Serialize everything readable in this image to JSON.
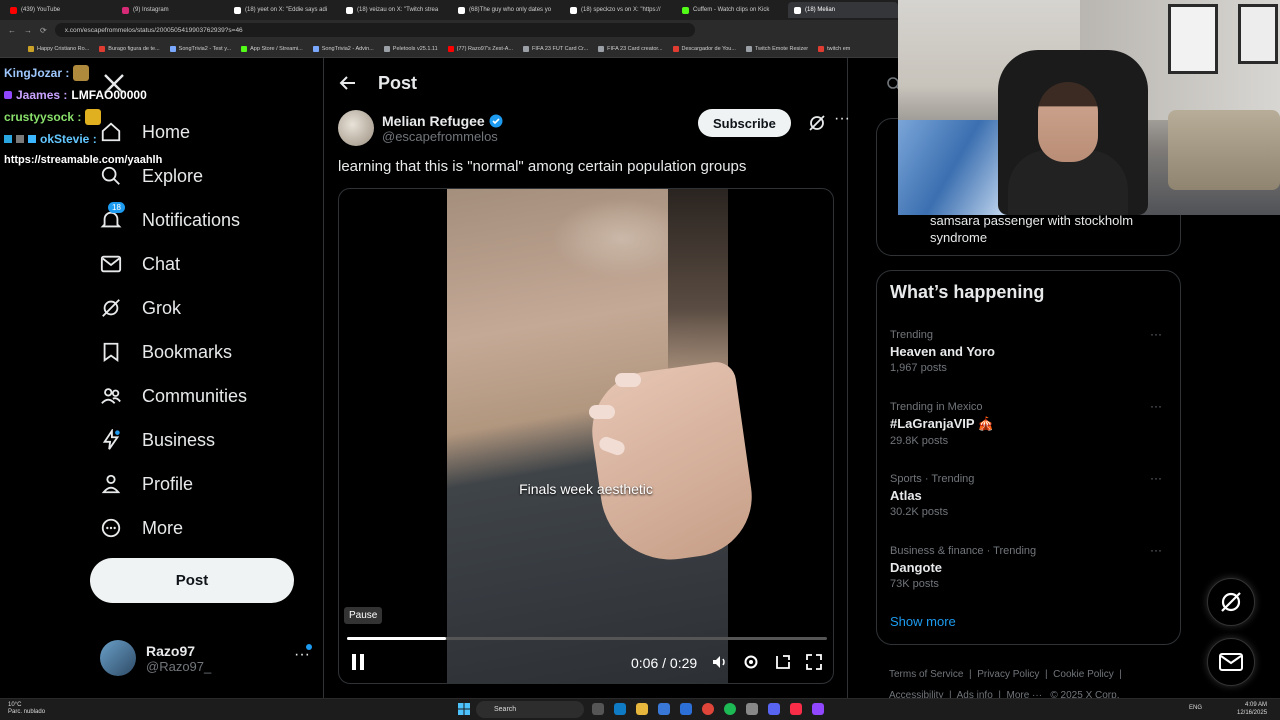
{
  "browser": {
    "tabs": [
      {
        "title": "(439) YouTube",
        "color": "#ff0000",
        "active": false
      },
      {
        "title": "(9) Instagram",
        "color": "#d62976",
        "active": false
      },
      {
        "title": "(18) yeet on X: \"Eddie says adi",
        "color": "#ffffff",
        "active": false
      },
      {
        "title": "(18) veizau on X: \"Twitch strea",
        "color": "#ffffff",
        "active": false
      },
      {
        "title": "(68)The guy who only dates yo",
        "color": "#ffffff",
        "active": false
      },
      {
        "title": "(18) speckzo vs on X: \"https://",
        "color": "#ffffff",
        "active": false
      },
      {
        "title": "Cuffem - Watch clips on Kick",
        "color": "#53fc18",
        "active": false
      },
      {
        "title": "(18) Melian",
        "color": "#ffffff",
        "active": true
      }
    ],
    "url": "x.com/escapefrommelos/status/2000505419903762939?s=46",
    "bookmarks": [
      {
        "label": "Happy Cristiano Ro...",
        "color": "#c9a227"
      },
      {
        "label": "Burago figura de te...",
        "color": "#e03c31"
      },
      {
        "label": "SongTrivia2 - Test y...",
        "color": "#7aa8ff"
      },
      {
        "label": "App Store / Streami...",
        "color": "#53fc18"
      },
      {
        "label": "SongTrivia2 - Advin...",
        "color": "#7aa8ff"
      },
      {
        "label": "Peletools v25.1.11",
        "color": "#9aa0a6"
      },
      {
        "label": "(77) Razo97's Zest-A...",
        "color": "#ff0000"
      },
      {
        "label": "FIFA 23 FUT Card Cr...",
        "color": "#9aa0a6"
      },
      {
        "label": "FIFA 23 Card creator...",
        "color": "#9aa0a6"
      },
      {
        "label": "Descargador de You...",
        "color": "#e03c31"
      },
      {
        "label": "Twitch Emote Resizer",
        "color": "#9aa0a6"
      },
      {
        "label": "twitch em",
        "color": "#e03c31"
      }
    ]
  },
  "chat": {
    "lines": [
      {
        "user": "KingJozar :",
        "message": "",
        "user_class": "user-kj"
      },
      {
        "user": "Jaames :",
        "message": "LMFAO00000",
        "user_class": "user-ja"
      },
      {
        "user": "crustyysock :",
        "message": "",
        "user_class": "user-cs"
      },
      {
        "user": "okStevie :",
        "message": "",
        "user_class": "user-ok"
      }
    ],
    "link": "https://streamable.com/yaahlh"
  },
  "sidebar": {
    "items": [
      {
        "label": "Home",
        "icon": "home-icon"
      },
      {
        "label": "Explore",
        "icon": "search-icon"
      },
      {
        "label": "Notifications",
        "icon": "bell-icon",
        "badge": "18"
      },
      {
        "label": "Chat",
        "icon": "mail-icon"
      },
      {
        "label": "Grok",
        "icon": "grok-icon"
      },
      {
        "label": "Bookmarks",
        "icon": "bookmark-icon"
      },
      {
        "label": "Communities",
        "icon": "communities-icon"
      },
      {
        "label": "Business",
        "icon": "lightning-icon"
      },
      {
        "label": "Profile",
        "icon": "person-icon"
      },
      {
        "label": "More",
        "icon": "more-circle-icon"
      }
    ],
    "post_button": "Post",
    "account": {
      "name": "Razo97",
      "handle": "@Razo97_"
    }
  },
  "post": {
    "header_title": "Post",
    "author_name": "Melian Refugee",
    "author_handle": "@escapefrommelos",
    "subscribe_label": "Subscribe",
    "text": "learning that this is \"normal\" among certain population groups",
    "video": {
      "caption": "Finals week aesthetic",
      "tooltip": "Pause",
      "current_time": "0:06",
      "duration": "0:29",
      "time_display": "0:06 / 0:29",
      "progress_fraction": 0.207
    }
  },
  "right": {
    "top_snippet": "samsara passenger with stockholm syndrome",
    "happening_title": "What’s happening",
    "trends": [
      {
        "meta": "Trending",
        "name": "Heaven and Yoro",
        "count": "1,967 posts"
      },
      {
        "meta": "Trending in Mexico",
        "name": "#LaGranjaVIP 🎪",
        "count": "29.8K posts"
      },
      {
        "meta": "Sports · Trending",
        "name": "Atlas",
        "count": "30.2K posts"
      },
      {
        "meta": "Business & finance · Trending",
        "name": "Dangote",
        "count": "73K posts"
      }
    ],
    "show_more": "Show more",
    "footer": {
      "terms": "Terms of Service",
      "privacy": "Privacy Policy",
      "cookie": "Cookie Policy",
      "accessibility": "Accessibility",
      "ads": "Ads info",
      "more": "More ···",
      "copyright": "© 2025 X Corp."
    }
  },
  "taskbar": {
    "weather_temp": "10°C",
    "weather_desc": "Parc. nublado",
    "search_label": "Search",
    "lang": "ENG",
    "time": "4:09 AM",
    "date": "12/16/2025"
  },
  "colors": {
    "accent": "#1d9bf0",
    "background": "#000000",
    "border": "#2f3336",
    "muted": "#71767b"
  }
}
